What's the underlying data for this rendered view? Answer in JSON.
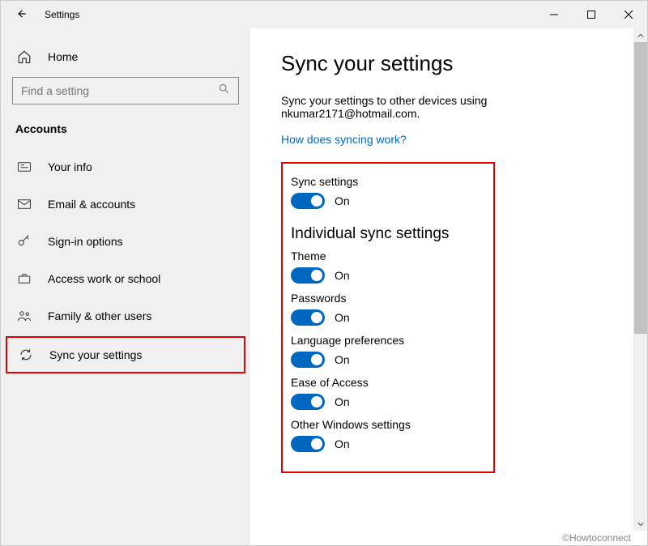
{
  "window": {
    "title": "Settings"
  },
  "sidebar": {
    "home_label": "Home",
    "search_placeholder": "Find a setting",
    "category": "Accounts",
    "items": [
      {
        "label": "Your info"
      },
      {
        "label": "Email & accounts"
      },
      {
        "label": "Sign-in options"
      },
      {
        "label": "Access work or school"
      },
      {
        "label": "Family & other users"
      },
      {
        "label": "Sync your settings"
      }
    ]
  },
  "main": {
    "heading": "Sync your settings",
    "subtext": "Sync your settings to other devices using nkumar2171@hotmail.com.",
    "help_link": "How does syncing work?",
    "sync_settings_label": "Sync settings",
    "sync_settings_state": "On",
    "section_heading": "Individual sync settings",
    "toggles": [
      {
        "label": "Theme",
        "state": "On"
      },
      {
        "label": "Passwords",
        "state": "On"
      },
      {
        "label": "Language preferences",
        "state": "On"
      },
      {
        "label": "Ease of Access",
        "state": "On"
      },
      {
        "label": "Other Windows settings",
        "state": "On"
      }
    ]
  },
  "watermark": "©Howtoconnect"
}
